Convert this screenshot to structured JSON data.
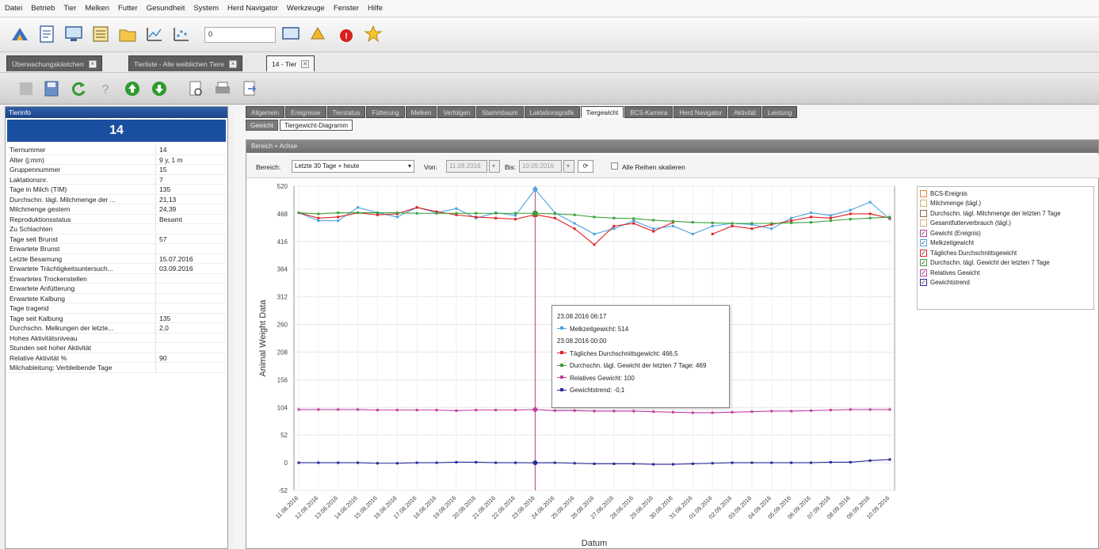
{
  "menu": [
    "Datei",
    "Betrieb",
    "Tier",
    "Melken",
    "Futter",
    "Gesundheit",
    "System",
    "Herd Navigator",
    "Werkzeuge",
    "Fenster",
    "Hilfe"
  ],
  "toolbar": {
    "combo_value": "0"
  },
  "doc_tabs": [
    {
      "label": "Überwachungskästchen",
      "active": false
    },
    {
      "label": "Tierliste - Alle weiblichen Tiere",
      "active": false
    },
    {
      "label": "14 - Tier",
      "active": true
    }
  ],
  "tierinfo": {
    "header": "Tierinfo",
    "animal_number": "14",
    "rows": [
      {
        "k": "Tiernummer",
        "v": "14"
      },
      {
        "k": "Alter (j:mm)",
        "v": "9 y, 1 m"
      },
      {
        "k": "Gruppennummer",
        "v": "15"
      },
      {
        "k": "Laktationsnr.",
        "v": "7"
      },
      {
        "k": "Tage in Milch (TIM)",
        "v": "135"
      },
      {
        "k": "Durchschn. tägl. Milchmenge der ...",
        "v": "21,13"
      },
      {
        "k": "Milchmenge gestern",
        "v": "24,39"
      },
      {
        "k": "Reproduktionsstatus",
        "v": "Besamt"
      },
      {
        "k": "Zu Schlachten",
        "v": ""
      },
      {
        "k": "Tage seit Brunst",
        "v": "57"
      },
      {
        "k": "Erwartete Brunst",
        "v": ""
      },
      {
        "k": "Letzte Besamung",
        "v": "15.07.2016"
      },
      {
        "k": "Erwartete Trächtigkeitsuntersuch...",
        "v": "03.09.2016"
      },
      {
        "k": "Erwartetes Trockenstellen",
        "v": ""
      },
      {
        "k": "Erwartete Anfütterung",
        "v": ""
      },
      {
        "k": "Erwartete Kalbung",
        "v": ""
      },
      {
        "k": "Tage tragend",
        "v": ""
      },
      {
        "k": "Tage seit Kalbung",
        "v": "135"
      },
      {
        "k": "Durchschn. Melkungen der letzte...",
        "v": "2,0"
      },
      {
        "k": "Hohes Aktivitätsniveau",
        "v": ""
      },
      {
        "k": "Stunden seit hoher Aktivität",
        "v": ""
      },
      {
        "k": "Relative Aktivität %",
        "v": "90"
      },
      {
        "k": "Milchableitung: Verbleibende Tage",
        "v": ""
      }
    ]
  },
  "main_tabs": [
    {
      "label": "Allgemein",
      "active": false
    },
    {
      "label": "Ereignisse",
      "active": false
    },
    {
      "label": "Tierstatus",
      "active": false
    },
    {
      "label": "Fütterung",
      "active": false
    },
    {
      "label": "Melken",
      "active": false
    },
    {
      "label": "Verfolgen",
      "active": false
    },
    {
      "label": "Stammbaum",
      "active": false
    },
    {
      "label": "Laktationsgrafik",
      "active": false
    },
    {
      "label": "Tiergewicht",
      "active": true
    },
    {
      "label": "BCS-Kamera",
      "active": false
    },
    {
      "label": "Herd Navigator",
      "active": false
    },
    {
      "label": "Aktivität",
      "active": false
    },
    {
      "label": "Leistung",
      "active": false
    }
  ],
  "sub_tabs": [
    {
      "label": "Gewicht",
      "active": false
    },
    {
      "label": "Tiergewicht-Diagramm",
      "active": true
    }
  ],
  "panel_header": "Bereich + Achse",
  "filter": {
    "bereich_label": "Bereich:",
    "bereich_value": "Letzte 30 Tage + heute",
    "von_label": "Von:",
    "von_value": "11.08.2016",
    "bis_label": "Bis:",
    "bis_value": "10.09.2016",
    "scale_label": "Alle Reihen skalieren"
  },
  "legend": [
    {
      "label": "BCS-Ereignis",
      "color": "#e08a3a",
      "checked": false
    },
    {
      "label": "Milchmenge (tägl.)",
      "color": "#c8b560",
      "checked": false
    },
    {
      "label": "Durchschn. tägl. Milchmenge der letzten 7 Tage",
      "color": "#8a6a40",
      "checked": false
    },
    {
      "label": "Gesamtfutterverbrauch (tägl.)",
      "color": "#d9b07a",
      "checked": false
    },
    {
      "label": "Gewicht (Ereignis)",
      "color": "#b040a0",
      "checked": true
    },
    {
      "label": "Melkzeitgewicht",
      "color": "#4aa3df",
      "checked": true
    },
    {
      "label": "Tägliches Durchschnittsgewicht",
      "color": "#e02020",
      "checked": true
    },
    {
      "label": "Durchschn. tägl. Gewicht der letzten 7 Tage",
      "color": "#3aa03a",
      "checked": true
    },
    {
      "label": "Relatives Gewicht",
      "color": "#c040a0",
      "checked": true
    },
    {
      "label": "Gewichtstrend",
      "color": "#2a2a9a",
      "checked": true
    }
  ],
  "tooltip": {
    "time1": "23.08.2016 06:17",
    "line1": "Melkzeitgewicht: 514",
    "time2": "23.08.2016 00:00",
    "line2": "Tägliches Durchschnittsgewicht: 466,5",
    "line3": "Durchschn. tägl. Gewicht der letzten 7 Tage: 469",
    "line4": "Relatives Gewicht: 100",
    "line5": "Gewichtstrend: -0,1"
  },
  "chart_data": {
    "type": "line",
    "ylabel": "Animal Weight Data",
    "xlabel": "Datum",
    "ylim": [
      -52,
      520
    ],
    "yticks": [
      520,
      468,
      416,
      364,
      312,
      260,
      208,
      156,
      104,
      52,
      0,
      -52
    ],
    "categories": [
      "11.08.2016",
      "12.08.2016",
      "13.08.2016",
      "14.08.2016",
      "15.08.2016",
      "16.08.2016",
      "17.08.2016",
      "18.08.2016",
      "19.08.2016",
      "20.08.2016",
      "21.08.2016",
      "22.08.2016",
      "23.08.2016",
      "24.08.2016",
      "25.08.2016",
      "26.08.2016",
      "27.08.2016",
      "28.08.2016",
      "29.08.2016",
      "30.08.2016",
      "31.08.2016",
      "01.09.2016",
      "02.09.2016",
      "03.09.2016",
      "04.09.2016",
      "05.09.2016",
      "06.09.2016",
      "07.09.2016",
      "08.09.2016",
      "09.09.2016",
      "10.09.2016"
    ],
    "grid": true,
    "series": [
      {
        "name": "Melkzeitgewicht",
        "color": "#4aa3df",
        "values": [
          470,
          455,
          455,
          480,
          470,
          462,
          480,
          470,
          478,
          460,
          470,
          465,
          514,
          470,
          450,
          430,
          440,
          455,
          440,
          445,
          430,
          445,
          450,
          448,
          440,
          460,
          470,
          465,
          475,
          490,
          458
        ]
      },
      {
        "name": "Tägliches Durchschnittsgewicht",
        "color": "#e02020",
        "values": [
          470,
          460,
          462,
          470,
          466,
          468,
          480,
          472,
          466,
          462,
          460,
          458,
          466.5,
          460,
          440,
          410,
          445,
          450,
          435,
          452,
          null,
          430,
          445,
          440,
          448,
          455,
          462,
          460,
          468,
          468,
          460
        ]
      },
      {
        "name": "Durchschn. tägl. Gewicht der letzten 7 Tage",
        "color": "#3aa03a",
        "values": [
          470,
          468,
          470,
          470,
          470,
          470,
          469,
          469,
          469,
          469,
          469,
          469,
          469,
          468,
          466,
          462,
          460,
          459,
          456,
          454,
          452,
          451,
          450,
          450,
          450,
          451,
          452,
          455,
          458,
          460,
          462
        ]
      },
      {
        "name": "Relatives Gewicht",
        "color": "#c040a0",
        "values": [
          100,
          100,
          100,
          100,
          99,
          99,
          99,
          99,
          98,
          99,
          99,
          99,
          100,
          98,
          98,
          97,
          97,
          97,
          96,
          95,
          94,
          94,
          95,
          96,
          97,
          97,
          98,
          99,
          100,
          100,
          100
        ]
      },
      {
        "name": "Gewichtstrend",
        "color": "#2a2a9a",
        "values": [
          0,
          0,
          0,
          0,
          -1,
          -1,
          0,
          0,
          1,
          1,
          0,
          0,
          -0.1,
          0,
          -1,
          -2,
          -2,
          -2,
          -3,
          -3,
          -2,
          -1,
          0,
          0,
          0,
          0,
          0,
          1,
          1,
          4,
          6
        ]
      }
    ]
  }
}
